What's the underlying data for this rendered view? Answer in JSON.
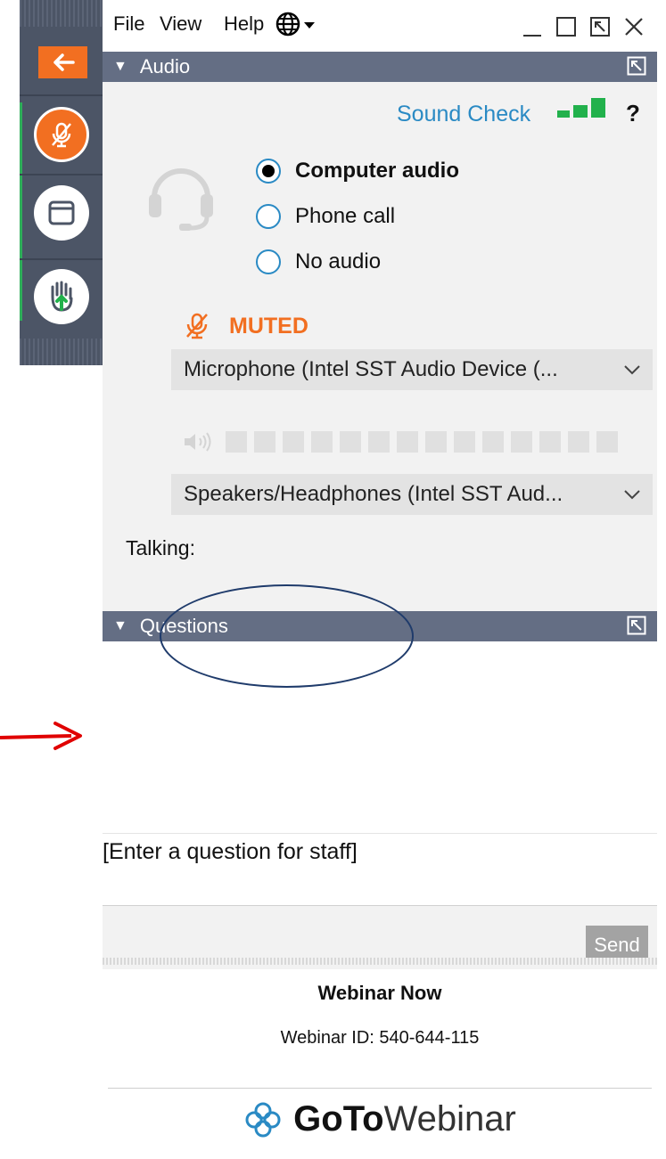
{
  "menu": {
    "file": "File",
    "view": "View",
    "help": "Help"
  },
  "audio": {
    "title": "Audio",
    "sound_check": "Sound Check",
    "help_mark": "?",
    "options": [
      {
        "label": "Computer audio",
        "selected": true
      },
      {
        "label": "Phone call",
        "selected": false
      },
      {
        "label": "No audio",
        "selected": false
      }
    ],
    "muted_label": "MUTED",
    "microphone": "Microphone (Intel SST Audio Device (... ",
    "speakers": "Speakers/Headphones (Intel SST Aud...",
    "talking_label": "Talking:"
  },
  "questions": {
    "title": "Questions",
    "input_placeholder": "[Enter a question for staff]",
    "send_label": "Send"
  },
  "footer": {
    "webinar_name": "Webinar Now",
    "webinar_id": "Webinar ID: 540-644-115",
    "logo_goto": "GoTo",
    "logo_webinar": "Webinar"
  },
  "colors": {
    "accent_orange": "#f26f21",
    "link_blue": "#2a8ac4",
    "header_slate": "#646e84",
    "toolbar_slate": "#4c5566",
    "signal_green": "#22b14c",
    "annotation_red": "#e00000",
    "annotation_navy": "#1f3b6b"
  },
  "icons": {
    "toolbar": [
      "back-arrow-icon",
      "mic-muted-icon",
      "screen-icon",
      "raise-hand-icon"
    ],
    "menu": [
      "globe-icon",
      "minimize-icon",
      "maximize-icon",
      "restore-icon",
      "close-icon"
    ],
    "audio": [
      "headset-icon",
      "signal-bars-icon",
      "mic-muted-icon",
      "speaker-icon",
      "chevron-down-icon"
    ]
  }
}
